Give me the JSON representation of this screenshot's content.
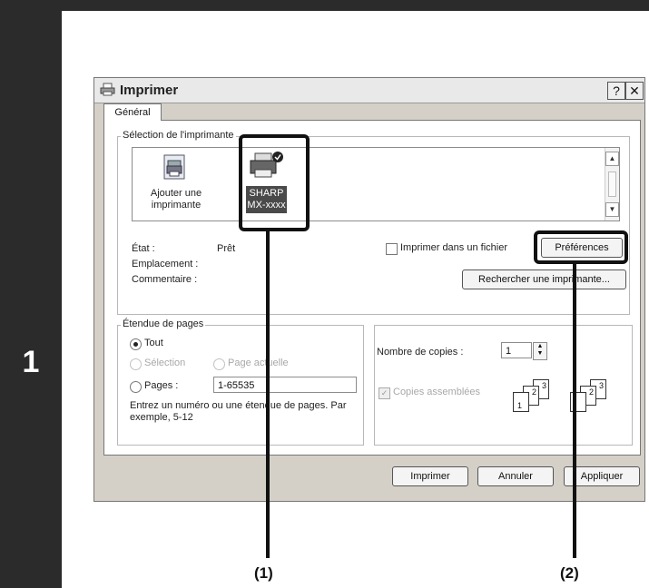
{
  "step": {
    "number": "1"
  },
  "dialog": {
    "title": "Imprimer",
    "help_label": "?",
    "close_label": "✕",
    "tab": "Général",
    "printer_section": {
      "label": "Sélection de l'imprimante",
      "add_printer": "Ajouter une imprimante",
      "selected_printer_line1": "SHARP",
      "selected_printer_line2": "MX-xxxx"
    },
    "status": {
      "state_label": "État :",
      "state_value": "Prêt",
      "location_label": "Emplacement :",
      "comment_label": "Commentaire :"
    },
    "print_to_file": "Imprimer dans un fichier",
    "preferences_button": "Préférences",
    "find_printer_button": "Rechercher une imprimante...",
    "page_range": {
      "label": "Étendue de pages",
      "all": "Tout",
      "selection": "Sélection",
      "current_page": "Page actuelle",
      "pages": "Pages :",
      "pages_value": "1-65535",
      "hint": "Entrez un numéro ou une étendue de pages. Par exemple, 5-12"
    },
    "copies": {
      "label": "Nombre de copies :",
      "value": "1",
      "collate": "Copies assemblées",
      "page_digits": [
        "1",
        "2",
        "3"
      ]
    },
    "buttons": {
      "print": "Imprimer",
      "cancel": "Annuler",
      "apply": "Appliquer"
    }
  },
  "callouts": {
    "one": "(1)",
    "two": "(2)"
  }
}
